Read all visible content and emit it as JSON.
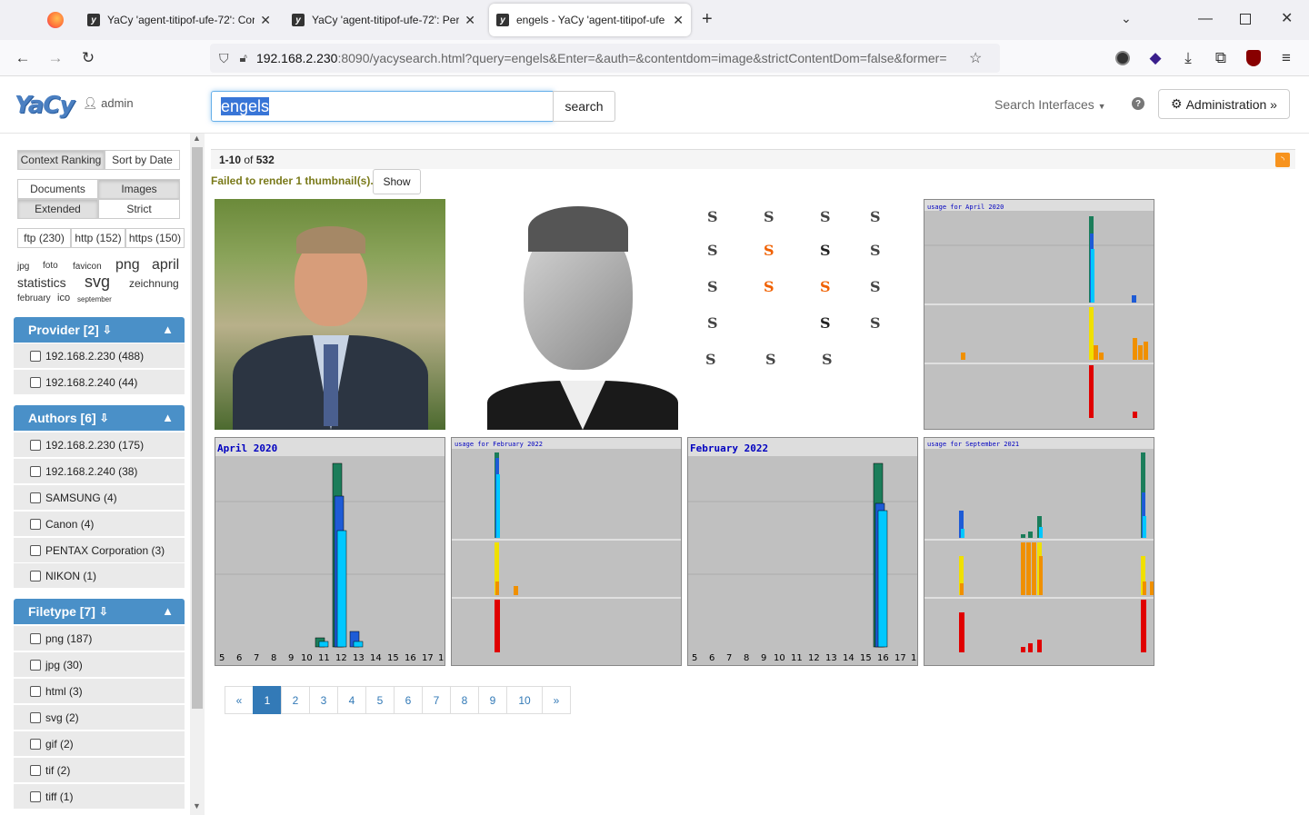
{
  "browser": {
    "tabs": [
      {
        "title": "YaCy 'agent-titipof-ufe-72': Cor"
      },
      {
        "title": "YaCy 'agent-titipof-ufe-72': Per"
      },
      {
        "title": "engels - YaCy 'agent-titipof-ufe"
      }
    ],
    "url_host": "192.168.2.230",
    "url_rest": ":8090/yacysearch.html?query=engels&Enter=&auth=&contentdom=image&strictContentDom=false&former="
  },
  "header": {
    "logo": "YaCy",
    "user": "admin",
    "query": "engels",
    "search_label": "search",
    "interfaces_label": "Search Interfaces",
    "admin_label": "Administration »"
  },
  "sidebar": {
    "ranking": [
      "Context Ranking",
      "Sort by Date"
    ],
    "domain": [
      "Documents",
      "Images"
    ],
    "mode": [
      "Extended",
      "Strict"
    ],
    "protocols": [
      "ftp (230)",
      "http (152)",
      "https (150)"
    ],
    "tags": [
      "jpg",
      "foto",
      "favicon",
      "png",
      "april",
      "statistics",
      "svg",
      "zeichnung",
      "february",
      "ico",
      "september"
    ],
    "provider": {
      "title": "Provider [2]",
      "items": [
        "192.168.2.230 (488)",
        "192.168.2.240 (44)"
      ]
    },
    "authors": {
      "title": "Authors [6]",
      "items": [
        "192.168.2.230 (175)",
        "192.168.2.240 (38)",
        "SAMSUNG (4)",
        "Canon (4)",
        "PENTAX Corporation (3)",
        "NIKON (1)"
      ]
    },
    "filetype": {
      "title": "Filetype [7]",
      "items": [
        "png (187)",
        "jpg (30)",
        "html (3)",
        "svg (2)",
        "gif (2)",
        "tif (2)",
        "tiff (1)"
      ]
    }
  },
  "results": {
    "range": "1-10",
    "of": "of",
    "total": "532",
    "failed_msg": "Failed to render 1 thumbnail(s).",
    "show_label": "Show",
    "chart_titles": [
      "usage for April 2020",
      "April 2020",
      "usage for February 2022",
      "February 2022",
      "usage for September 2021"
    ]
  },
  "pagination": [
    "«",
    "1",
    "2",
    "3",
    "4",
    "5",
    "6",
    "7",
    "8",
    "9",
    "10",
    "»"
  ],
  "colors": {
    "accent": "#4a90c8",
    "link": "#337ab7"
  }
}
